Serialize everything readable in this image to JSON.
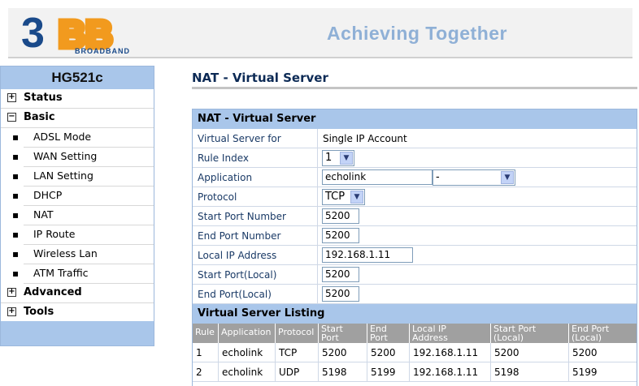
{
  "header": {
    "logo_text": "3BB",
    "logo_sub": "BROADBAND",
    "slogan": "Achieving Together",
    "colors": {
      "brand_blue": "#1a4a8a",
      "brand_orange": "#f29a1e",
      "slogan": "#8fb0d6"
    }
  },
  "sidebar": {
    "title": "HG521c",
    "items": [
      {
        "label": "Status",
        "type": "top",
        "icon": "plus-box-icon",
        "icon_char": "+"
      },
      {
        "label": "Basic",
        "type": "top",
        "icon": "minus-box-icon",
        "icon_char": "−"
      },
      {
        "label": "ADSL Mode",
        "type": "sub"
      },
      {
        "label": "WAN Setting",
        "type": "sub"
      },
      {
        "label": "LAN Setting",
        "type": "sub"
      },
      {
        "label": "DHCP",
        "type": "sub"
      },
      {
        "label": "NAT",
        "type": "sub"
      },
      {
        "label": "IP Route",
        "type": "sub"
      },
      {
        "label": "Wireless Lan",
        "type": "sub"
      },
      {
        "label": "ATM Traffic",
        "type": "sub"
      },
      {
        "label": "Advanced",
        "type": "top",
        "icon": "plus-box-icon",
        "icon_char": "+"
      },
      {
        "label": "Tools",
        "type": "top",
        "icon": "plus-box-icon",
        "icon_char": "+"
      }
    ]
  },
  "main": {
    "page_title": "NAT - Virtual Server",
    "form": {
      "section_title": "NAT - Virtual Server",
      "fields": {
        "virtual_server_for": {
          "label": "Virtual Server for",
          "value": "Single IP Account"
        },
        "rule_index": {
          "label": "Rule Index",
          "value": "1"
        },
        "application": {
          "label": "Application",
          "value": "echolink",
          "select_value": "-"
        },
        "protocol": {
          "label": "Protocol",
          "value": "TCP"
        },
        "start_port": {
          "label": "Start Port Number",
          "value": "5200"
        },
        "end_port": {
          "label": "End Port Number",
          "value": "5200"
        },
        "local_ip": {
          "label": "Local IP Address",
          "value": "192.168.1.11"
        },
        "start_port_local": {
          "label": "Start Port(Local)",
          "value": "5200"
        },
        "end_port_local": {
          "label": "End Port(Local)",
          "value": "5200"
        }
      }
    },
    "listing": {
      "section_title": "Virtual Server Listing",
      "headers": [
        {
          "l1": "Rule",
          "l2": ""
        },
        {
          "l1": "Application",
          "l2": ""
        },
        {
          "l1": "Protocol",
          "l2": ""
        },
        {
          "l1": "Start",
          "l2": "Port"
        },
        {
          "l1": "End",
          "l2": "Port"
        },
        {
          "l1": "Local IP",
          "l2": "Address"
        },
        {
          "l1": "Start Port",
          "l2": "(Local)"
        },
        {
          "l1": "End Port",
          "l2": "(Local)"
        }
      ],
      "rows": [
        [
          "1",
          "echolink",
          "TCP",
          "5200",
          "5200",
          "192.168.1.11",
          "5200",
          "5200"
        ],
        [
          "2",
          "echolink",
          "UDP",
          "5198",
          "5199",
          "192.168.1.11",
          "5198",
          "5199"
        ]
      ]
    }
  }
}
